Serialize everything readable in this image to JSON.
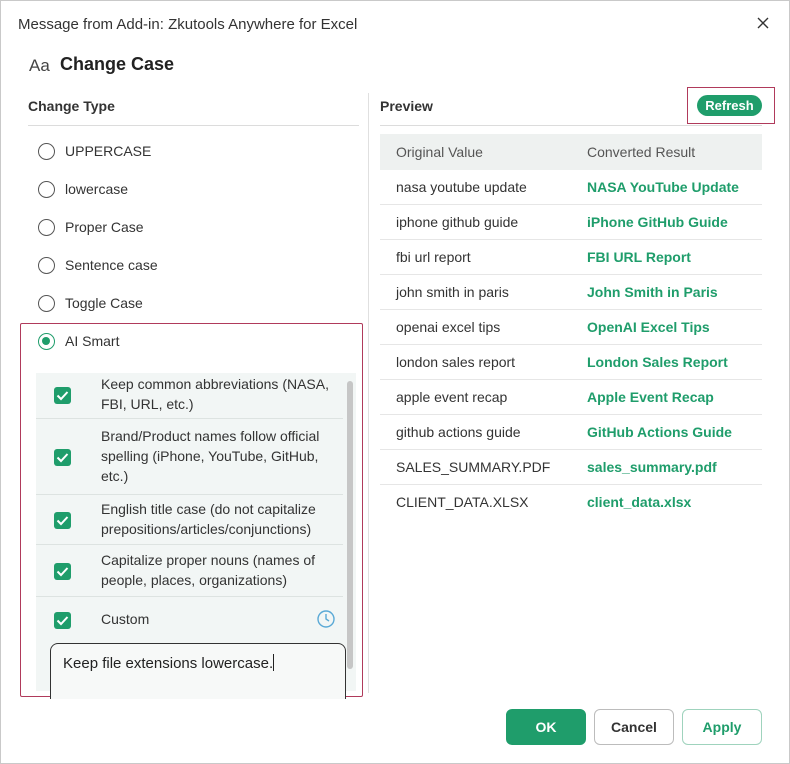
{
  "window": {
    "title": "Message from Add-in: Zkutools Anywhere for Excel",
    "close_icon": "close-icon"
  },
  "heading": {
    "icon_text": "Aa",
    "title": "Change Case"
  },
  "change_type": {
    "title": "Change Type",
    "options": [
      {
        "label": "UPPERCASE",
        "selected": false
      },
      {
        "label": "lowercase",
        "selected": false
      },
      {
        "label": "Proper Case",
        "selected": false
      },
      {
        "label": "Sentence case",
        "selected": false
      },
      {
        "label": "Toggle Case",
        "selected": false
      },
      {
        "label": "AI Smart",
        "selected": true
      }
    ]
  },
  "ai_options": {
    "items": [
      {
        "label": "Keep common abbreviations (NASA, FBI, URL, etc.)",
        "checked": true
      },
      {
        "label": "Brand/Product names follow official spelling (iPhone, YouTube, GitHub, etc.)",
        "checked": true
      },
      {
        "label": "English title case (do not capitalize prepositions/articles/conjunctions)",
        "checked": true
      },
      {
        "label": "Capitalize proper nouns (names of people, places, organizations)",
        "checked": true
      },
      {
        "label": "Custom",
        "checked": true
      }
    ],
    "custom_icon": "clock-icon",
    "custom_text": "Keep file extensions lowercase."
  },
  "preview": {
    "title": "Preview",
    "refresh_label": "Refresh",
    "columns": [
      "Original Value",
      "Converted Result"
    ],
    "rows": [
      {
        "original": "nasa youtube update",
        "converted": "NASA YouTube Update"
      },
      {
        "original": "iphone github guide",
        "converted": "iPhone GitHub Guide"
      },
      {
        "original": "fbi url report",
        "converted": "FBI URL Report"
      },
      {
        "original": "john smith in paris",
        "converted": "John Smith in Paris"
      },
      {
        "original": "openai excel tips",
        "converted": "OpenAI Excel Tips"
      },
      {
        "original": "london sales report",
        "converted": "London Sales Report"
      },
      {
        "original": "apple event recap",
        "converted": "Apple Event Recap"
      },
      {
        "original": "github actions guide",
        "converted": "GitHub Actions Guide"
      },
      {
        "original": "SALES_SUMMARY.PDF",
        "converted": "sales_summary.pdf"
      },
      {
        "original": "CLIENT_DATA.XLSX",
        "converted": "client_data.xlsx"
      }
    ]
  },
  "footer": {
    "ok_label": "OK",
    "cancel_label": "Cancel",
    "apply_label": "Apply"
  },
  "colors": {
    "accent": "#1f9d6b",
    "highlight_border": "#b03a5b"
  }
}
